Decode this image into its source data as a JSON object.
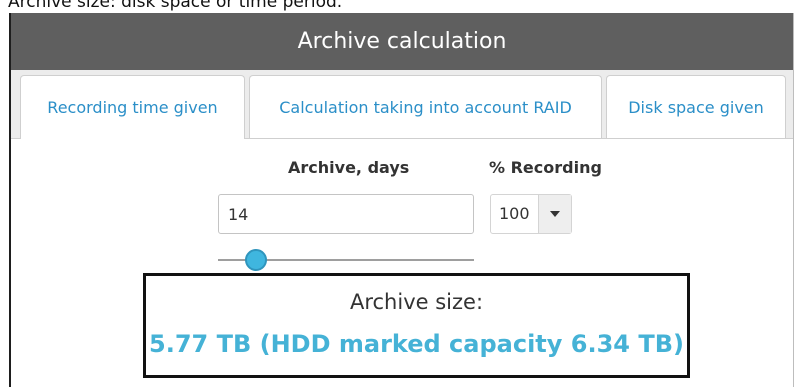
{
  "page": {
    "caption": "Archive size: disk space or time period."
  },
  "window": {
    "title": "Archive calculation"
  },
  "tabs": [
    {
      "label": "Recording time given",
      "active": true
    },
    {
      "label": "Calculation taking into account RAID",
      "active": false
    },
    {
      "label": "Disk space given",
      "active": false
    }
  ],
  "form": {
    "archive_days": {
      "label": "Archive, days",
      "value": "14",
      "slider_fraction": 0.15
    },
    "recording_percent": {
      "label": "% Recording",
      "selected": "100"
    }
  },
  "result": {
    "title": "Archive size:",
    "value": "5.77 TB (HDD marked capacity 6.34 TB)"
  },
  "colors": {
    "header_bg": "#5f5f5f",
    "tab_link": "#2b8fc8",
    "result_value": "#45b2d6",
    "slider_thumb": "#3fb6df"
  },
  "icons": {
    "dropdown": "caret-down-icon"
  }
}
